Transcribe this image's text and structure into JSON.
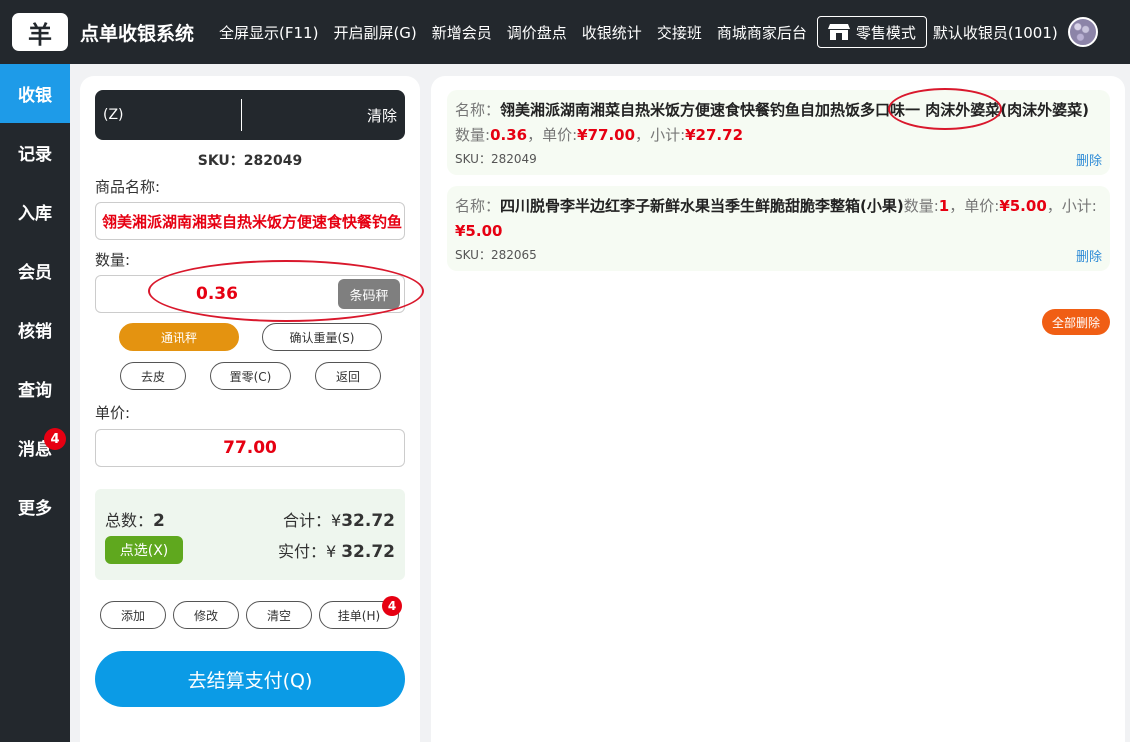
{
  "header": {
    "logo_glyph": "羊",
    "title": "点单收银系统",
    "menu": [
      "全屏显示(F11)",
      "开启副屏(G)",
      "新增会员",
      "调价盘点",
      "收银统计",
      "交接班",
      "商城商家后台"
    ],
    "retail_mode": "零售模式",
    "cashier": "默认收银员(1001)"
  },
  "sidenav": {
    "items": [
      {
        "label": "收银",
        "active": true
      },
      {
        "label": "记录"
      },
      {
        "label": "入库"
      },
      {
        "label": "会员"
      },
      {
        "label": "核销"
      },
      {
        "label": "查询"
      },
      {
        "label": "消息",
        "badge": "4"
      },
      {
        "label": "更多"
      }
    ]
  },
  "left": {
    "scan_placeholder": "(Z)",
    "clear": "清除",
    "sku_label": "SKU：",
    "sku": "282049",
    "name_label": "商品名称:",
    "name_value": "翎美湘派湖南湘菜自热米饭方便速食快餐钓鱼自加热饭多",
    "qty_label": "数量:",
    "qty_value": "0.36",
    "scale_btn": "条码秤",
    "comm_scale": "通讯秤",
    "confirm_weight": "确认重量(S)",
    "tare": "去皮",
    "zero": "置零(C)",
    "back": "返回",
    "price_label": "单价:",
    "price_value": "77.00",
    "summary": {
      "total_count_label": "总数：",
      "total_count": "2",
      "sum_label": "合计：¥",
      "sum": "32.72",
      "select_btn": "点选(X)",
      "paid_label": "实付：¥ ",
      "paid": "32.72"
    },
    "actions": {
      "add": "添加",
      "modify": "修改",
      "clear": "清空",
      "hold": "挂单(H)",
      "hold_badge": "4"
    },
    "pay": "去结算支付(Q)"
  },
  "cart": {
    "items": [
      {
        "name_label": "名称：",
        "name": "翎美湘派湖南湘菜自热米饭方便速食快餐钓鱼自加热饭多口味一 肉沫外婆菜(肉沫外婆菜)",
        "qty_label": "数量:",
        "qty": "0.36",
        "price_label": "单价:",
        "price": "¥77.00",
        "subtotal_label": "小计:",
        "subtotal": "¥27.72",
        "sku_label": "SKU：",
        "sku": "282049",
        "delete": "删除"
      },
      {
        "name_label": "名称：",
        "name": "四川脱骨李半边红李子新鲜水果当季生鲜脆甜脆李整箱(小果)",
        "qty_label": "数量:",
        "qty": "1",
        "price_label": "单价:",
        "price": "¥5.00",
        "subtotal_label": "小计:",
        "subtotal": "¥5.00",
        "sku_label": "SKU：",
        "sku": "282065",
        "delete": "删除"
      }
    ],
    "delete_all": "全部删除"
  },
  "colors": {
    "dark": "#23282d",
    "accent_blue": "#1e9be8",
    "price_red": "#e60012",
    "orange": "#e49310"
  }
}
